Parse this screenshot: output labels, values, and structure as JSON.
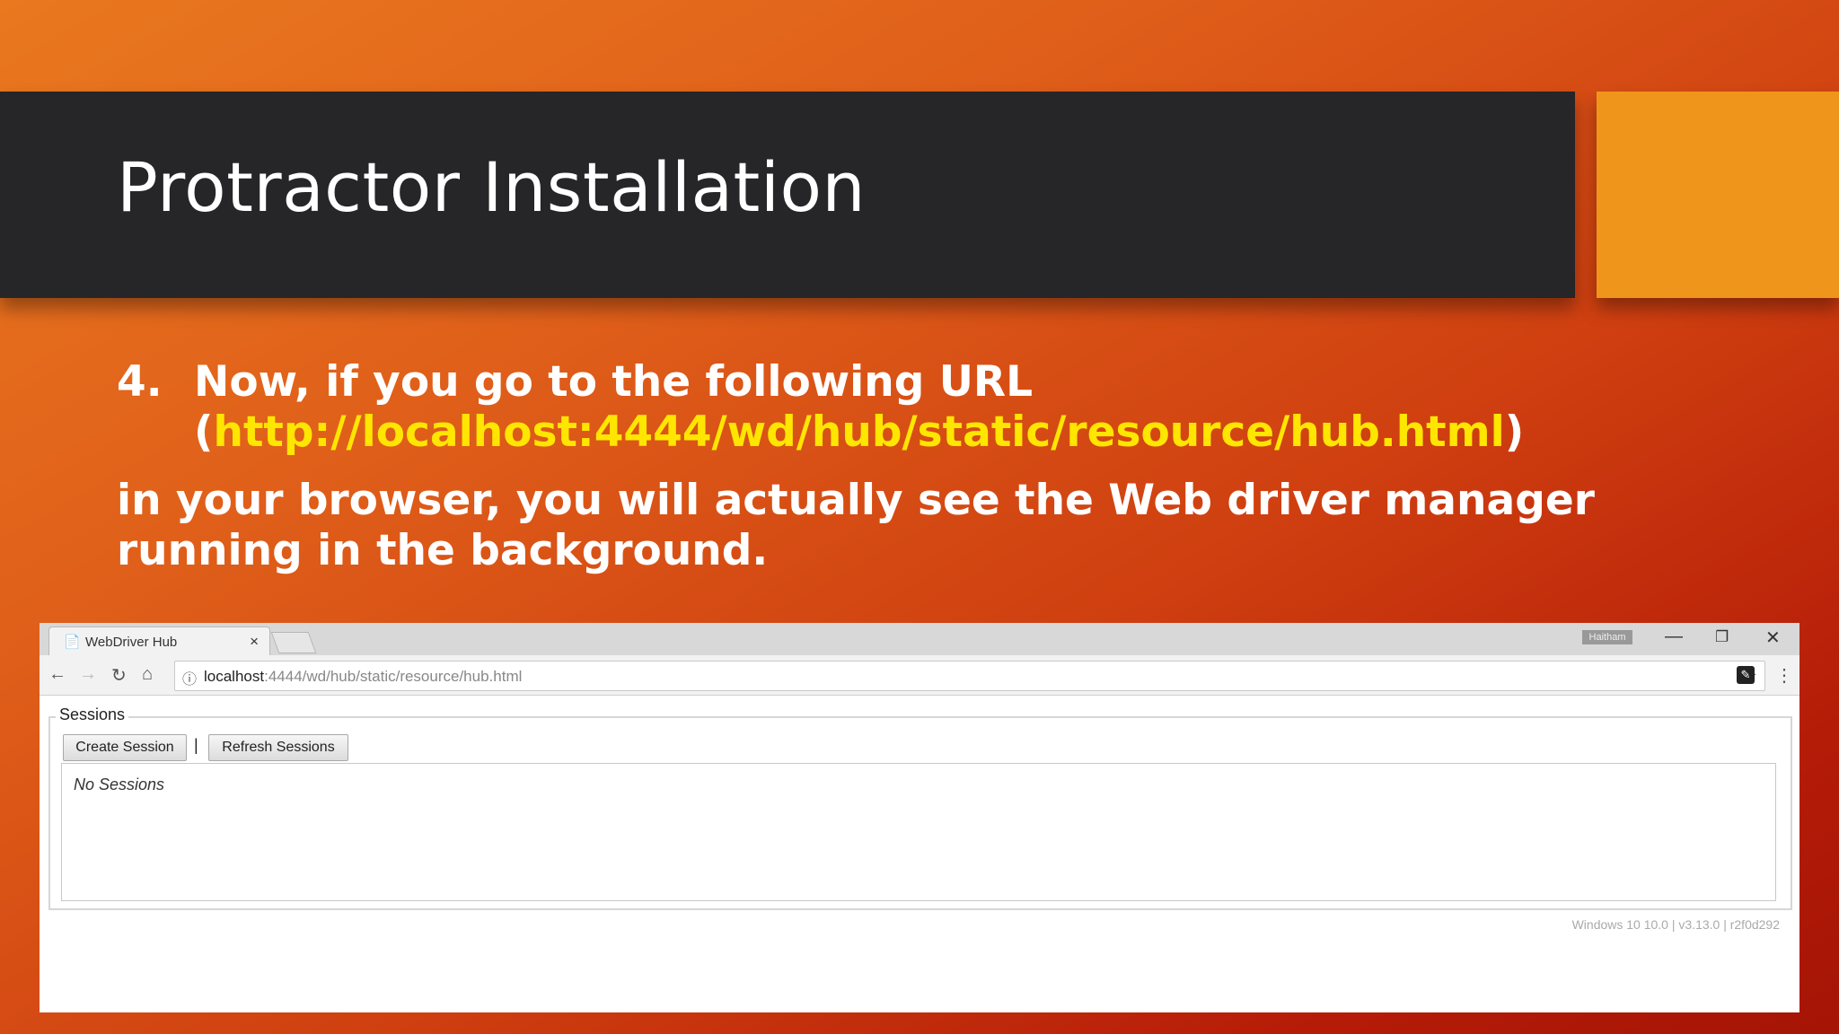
{
  "slide": {
    "title": "Protractor Installation",
    "item_number": "4.",
    "item_line1": "Now, if you go to the following URL",
    "item_open_paren": "(",
    "item_url": "http://localhost:4444/wd/hub/static/resource/hub.html",
    "item_close_paren": ")",
    "paragraph": "in your browser, you will actually see the Web driver manager running in the background."
  },
  "colors": {
    "title_bar": "#262528",
    "accent_box": "#f0951b",
    "url_highlight": "#ffe600",
    "background_start": "#e9781f",
    "background_end": "#a51405"
  },
  "browser": {
    "tab_title": "WebDriver Hub",
    "tab_close": "×",
    "profile_name": "Haitham",
    "address_host": "localhost",
    "address_path": ":4444/wd/hub/static/resource/hub.html",
    "icons": {
      "page": "📄",
      "back": "←",
      "forward": "→",
      "reload": "↻",
      "home": "⌂",
      "info": "ⓘ",
      "star": "☆",
      "extension": "✎",
      "menu": "⋮",
      "minimize": "—",
      "maximize": "❐",
      "close": "✕"
    }
  },
  "hub": {
    "sessions_legend": "Sessions",
    "create_session": "Create Session",
    "separator": "|",
    "refresh_sessions": "Refresh Sessions",
    "no_sessions": "No Sessions",
    "footer": "Windows 10 10.0  |  v3.13.0  |  r2f0d292"
  }
}
